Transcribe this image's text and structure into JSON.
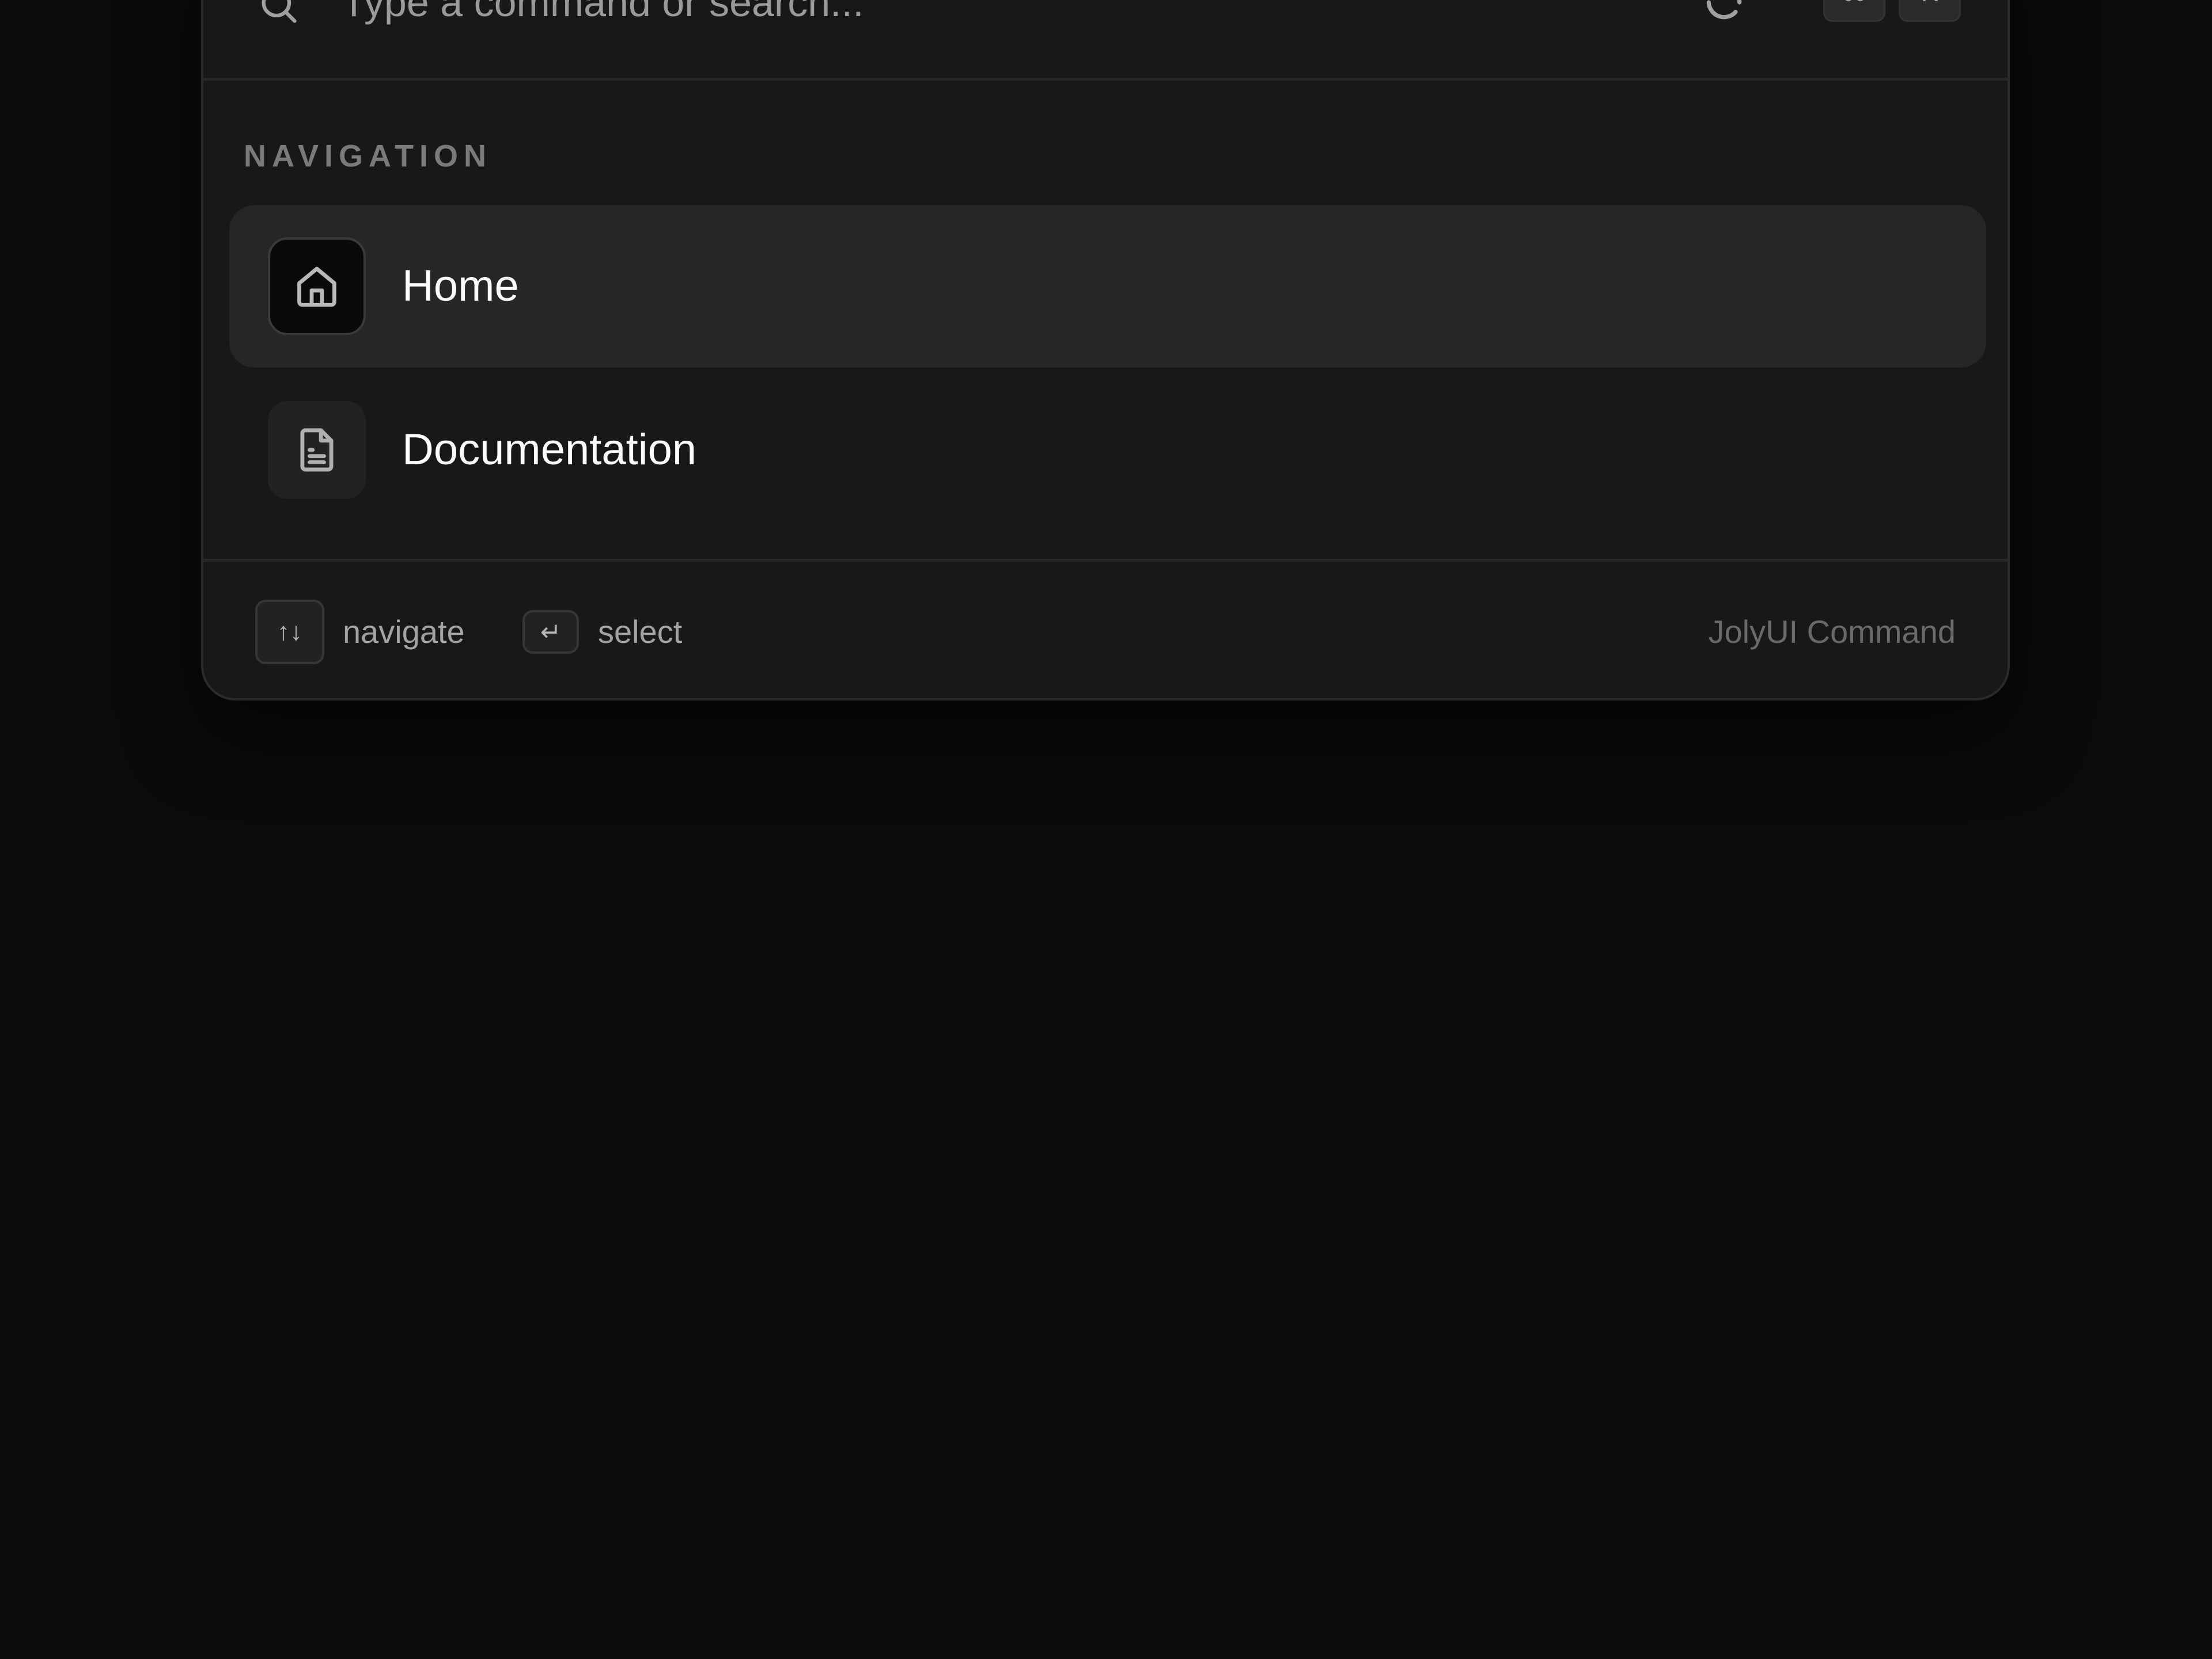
{
  "search": {
    "placeholder": "Type a command or search..."
  },
  "shortcut": {
    "modifier_key": "⌘",
    "letter_key": "K"
  },
  "group": {
    "heading": "NAVIGATION",
    "items": [
      {
        "label": "Home",
        "icon": "home-icon",
        "selected": true
      },
      {
        "label": "Documentation",
        "icon": "document-icon",
        "selected": false
      }
    ]
  },
  "footer": {
    "navigate_key": "↑↓",
    "navigate_label": "navigate",
    "select_key": "↵",
    "select_label": "select",
    "brand": "JolyUI Command"
  },
  "colors": {
    "background": "#0b0b0b",
    "panel": "#181818",
    "selected_row": "#262626",
    "text_primary": "#ffffff",
    "text_muted": "#7a7a7a"
  }
}
